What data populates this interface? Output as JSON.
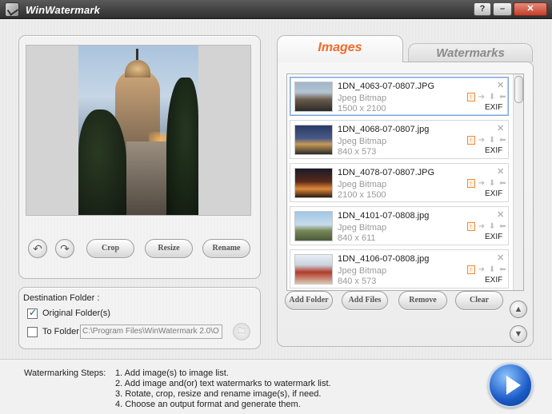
{
  "window": {
    "title": "WinWatermark",
    "help_label": "?",
    "minimize_label": "–",
    "close_label": "✕"
  },
  "preview": {
    "rotate_left_icon": "↶",
    "rotate_right_icon": "↷",
    "crop_label": "Crop",
    "resize_label": "Resize",
    "rename_label": "Rename"
  },
  "destination": {
    "label": "Destination Folder :",
    "original_label": "Original Folder(s)",
    "original_checked": true,
    "to_folder_label": "To Folder",
    "to_folder_checked": false,
    "path": "C:\\Program Files\\WinWatermark 2.0\\O",
    "browse_icon": "folder-icon"
  },
  "tabs": {
    "images": "Images",
    "watermarks": "Watermarks"
  },
  "images": [
    {
      "name": "1DN_4063-07-0807.JPG",
      "type": "Jpeg Bitmap",
      "dims": "1500 x 2100",
      "exif": "EXIF",
      "selected": true
    },
    {
      "name": "1DN_4068-07-0807.jpg",
      "type": "Jpeg Bitmap",
      "dims": "840 x 573",
      "exif": "EXIF",
      "selected": false
    },
    {
      "name": "1DN_4078-07-0807.JPG",
      "type": "Jpeg Bitmap",
      "dims": "2100 x 1500",
      "exif": "EXIF",
      "selected": false
    },
    {
      "name": "1DN_4101-07-0808.jpg",
      "type": "Jpeg Bitmap",
      "dims": "840 x 611",
      "exif": "EXIF",
      "selected": false
    },
    {
      "name": "1DN_4106-07-0808.jpg",
      "type": "Jpeg Bitmap",
      "dims": "840 x 573",
      "exif": "EXIF",
      "selected": false
    }
  ],
  "list_actions": {
    "add_folder": "Add Folder",
    "add_files": "Add Files",
    "remove": "Remove",
    "clear": "Clear"
  },
  "steps": {
    "label": "Watermarking Steps:",
    "items": [
      "1. Add image(s) to image list.",
      "2. Add image and(or) text watermarks to watermark list.",
      "3. Rotate, crop, resize and rename image(s), if need.",
      "4. Choose an output format and generate them."
    ]
  }
}
